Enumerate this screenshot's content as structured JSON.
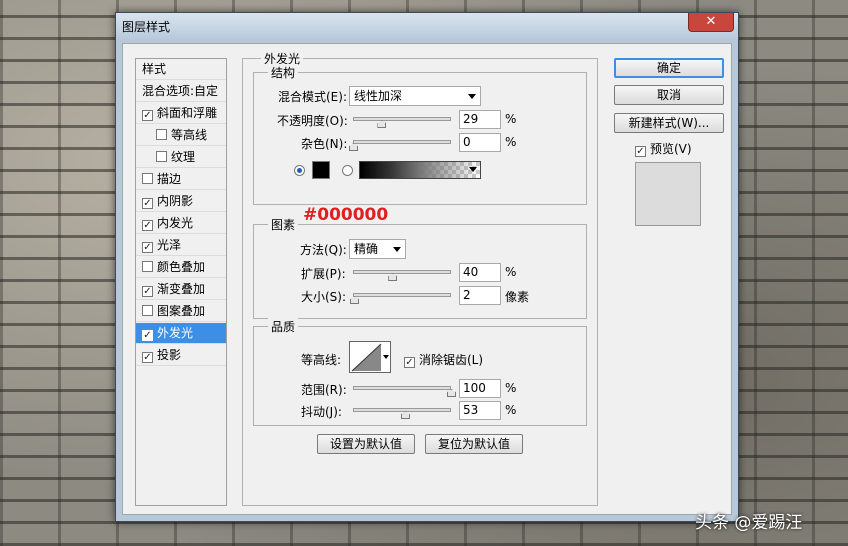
{
  "window": {
    "title": "图层样式",
    "close_symbol": "✕"
  },
  "sidebar": {
    "items": [
      {
        "label": "样式",
        "checkbox": false,
        "checked": false,
        "indent": 0,
        "active": false
      },
      {
        "label": "混合选项:自定",
        "checkbox": false,
        "checked": false,
        "indent": 0,
        "active": false
      },
      {
        "label": "斜面和浮雕",
        "checkbox": true,
        "checked": true,
        "indent": 0,
        "active": false
      },
      {
        "label": "等高线",
        "checkbox": true,
        "checked": false,
        "indent": 1,
        "active": false
      },
      {
        "label": "纹理",
        "checkbox": true,
        "checked": false,
        "indent": 1,
        "active": false
      },
      {
        "label": "描边",
        "checkbox": true,
        "checked": false,
        "indent": 0,
        "active": false
      },
      {
        "label": "内阴影",
        "checkbox": true,
        "checked": true,
        "indent": 0,
        "active": false
      },
      {
        "label": "内发光",
        "checkbox": true,
        "checked": true,
        "indent": 0,
        "active": false
      },
      {
        "label": "光泽",
        "checkbox": true,
        "checked": true,
        "indent": 0,
        "active": false
      },
      {
        "label": "颜色叠加",
        "checkbox": true,
        "checked": false,
        "indent": 0,
        "active": false
      },
      {
        "label": "渐变叠加",
        "checkbox": true,
        "checked": true,
        "indent": 0,
        "active": false
      },
      {
        "label": "图案叠加",
        "checkbox": true,
        "checked": false,
        "indent": 0,
        "active": false
      },
      {
        "label": "外发光",
        "checkbox": true,
        "checked": true,
        "indent": 0,
        "active": true
      },
      {
        "label": "投影",
        "checkbox": true,
        "checked": true,
        "indent": 0,
        "active": false
      }
    ]
  },
  "outer_glow": {
    "title": "外发光",
    "structure": {
      "title": "结构",
      "blend_mode_label": "混合模式(E):",
      "blend_mode_value": "线性加深",
      "opacity_label": "不透明度(O):",
      "opacity_value": "29",
      "opacity_level": 0.29,
      "noise_label": "杂色(N):",
      "noise_value": "0",
      "noise_level": 0,
      "percent": "%",
      "color_hex": "#000000",
      "color_radio_selected": "solid"
    },
    "elements": {
      "title": "图素",
      "technique_label": "方法(Q):",
      "technique_value": "精确",
      "spread_label": "扩展(P):",
      "spread_value": "40",
      "spread_level": 0.4,
      "size_label": "大小(S):",
      "size_value": "2",
      "size_level": 0.01,
      "size_unit": "像素"
    },
    "quality": {
      "title": "品质",
      "contour_label": "等高线:",
      "antialias_label": "消除锯齿(L)",
      "antialias_checked": true,
      "range_label": "范围(R):",
      "range_value": "100",
      "range_level": 1.0,
      "jitter_label": "抖动(J):",
      "jitter_value": "53",
      "jitter_level": 0.53
    },
    "set_default_button": "设置为默认值",
    "reset_default_button": "复位为默认值"
  },
  "right": {
    "ok_button": "确定",
    "cancel_button": "取消",
    "new_style_button": "新建样式(W)...",
    "preview_label": "预览(V)",
    "preview_checked": true
  },
  "annotation": {
    "text": "#000000",
    "color": "#e02020"
  },
  "watermark": {
    "text": "头条 @爱踢汪"
  },
  "colors": {
    "accent": "#3c8fe6",
    "glow_color": "#000000"
  }
}
